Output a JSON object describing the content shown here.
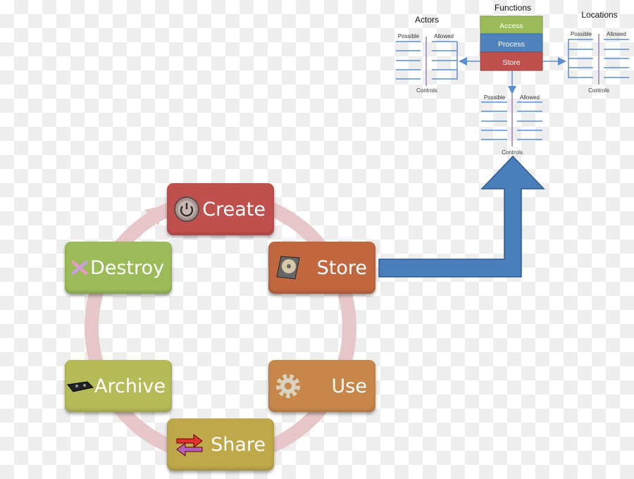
{
  "functions_panel": {
    "title": "Functions",
    "items": [
      {
        "label": "Access",
        "color": "#9bbb59"
      },
      {
        "label": "Process",
        "color": "#4f81bd"
      },
      {
        "label": "Store",
        "color": "#c0504d"
      }
    ]
  },
  "actors": {
    "title": "Actors",
    "possible": "Possible",
    "allowed": "Allowed",
    "controls": "Controls"
  },
  "locations": {
    "title": "Locations",
    "possible": "Possible",
    "allowed": "Allowed",
    "controls": "Controls"
  },
  "store_detail": {
    "possible": "Possible",
    "allowed": "Allowed",
    "controls": "Controls"
  },
  "lifecycle": [
    {
      "label": "Create",
      "icon": "power-button-icon",
      "color": "#c0504d"
    },
    {
      "label": "Store",
      "icon": "hard-drive-icon",
      "color": "#c0673f"
    },
    {
      "label": "Use",
      "icon": "gear-icon",
      "color": "#c8874a"
    },
    {
      "label": "Share",
      "icon": "exchange-arrows-icon",
      "color": "#bea84a"
    },
    {
      "label": "Archive",
      "icon": "tape-cartridge-icon",
      "color": "#b5bb59"
    },
    {
      "label": "Destroy",
      "icon": "x-mark-icon",
      "color": "#9bbb59"
    }
  ],
  "colors": {
    "arrow": "#4a7ebb",
    "cycle_ring": "#e6c6c8",
    "control_line": "#9b7bbd",
    "list_line": "#5b8fd0"
  }
}
